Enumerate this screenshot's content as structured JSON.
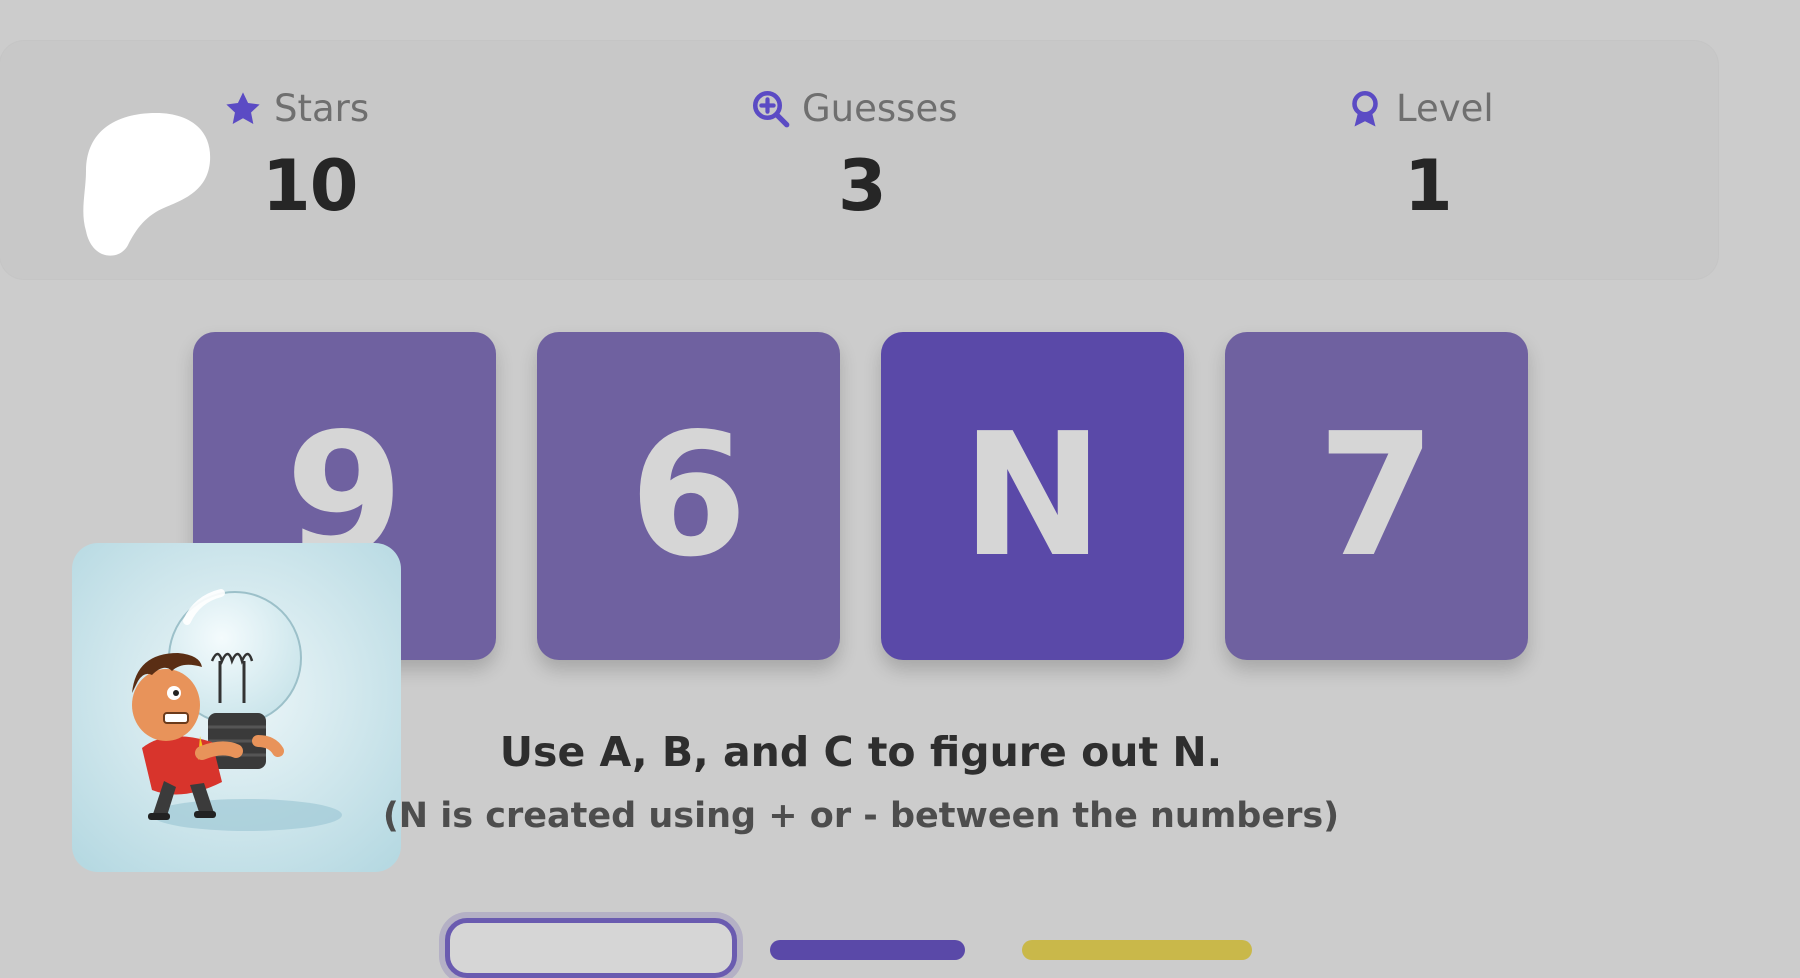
{
  "stats": {
    "stars": {
      "label": "Stars",
      "value": "10",
      "icon": "star-icon"
    },
    "guesses": {
      "label": "Guesses",
      "value": "3",
      "icon": "zoom-plus-icon"
    },
    "level": {
      "label": "Level",
      "value": "1",
      "icon": "award-ribbon-icon"
    }
  },
  "tiles": [
    "9",
    "6",
    "N",
    "7"
  ],
  "instructions": {
    "main": "Use A, B, and C to figure out N.",
    "sub": "(N is created using + or - between the numbers)"
  },
  "colors": {
    "accent": "#5a49a8",
    "tile": "#6f61a0",
    "icon": "#5b4bc4"
  }
}
